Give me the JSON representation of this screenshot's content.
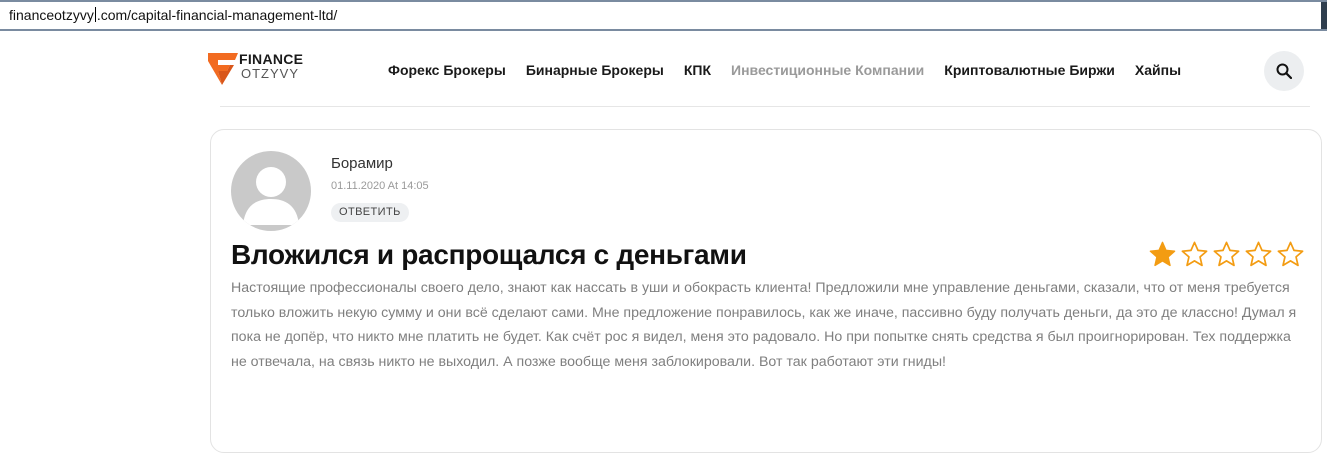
{
  "browser": {
    "url_host": "financeotzyvy",
    "url_path": ".com/capital-financial-management-ltd/"
  },
  "logo": {
    "line1": "FINANCE",
    "line2": "OTZYVY",
    "accent_color": "#f26b21"
  },
  "nav": {
    "items": [
      {
        "label": "Форекс Брокеры",
        "active": false
      },
      {
        "label": "Бинарные Брокеры",
        "active": false
      },
      {
        "label": "КПК",
        "active": false
      },
      {
        "label": "Инвестиционные Компании",
        "active": true
      },
      {
        "label": "Криптовалютные Биржи",
        "active": false
      },
      {
        "label": "Хайпы",
        "active": false
      }
    ],
    "search_icon": "search-icon"
  },
  "comment": {
    "author": "Борамир",
    "date": "01.11.2020 At 14:05",
    "reply_label": "ОТВЕТИТЬ",
    "title": "Вложился и распрощался с деньгами",
    "rating": 1,
    "rating_max": 5,
    "star_color": "#f39c12",
    "body": "Настоящие профессионалы своего дело, знают как нассать в уши и обокрасть клиента! Предложили мне управление деньгами, сказали, что от меня требуется только вложить некую сумму и они всё сделают сами. Мне предложение понравилось, как же иначе, пассивно буду получать деньги, да это де классно! Думал я пока не допёр, что никто мне платить не будет. Как счёт рос я видел, меня это радовало. Но при попытке снять средства я был проигнорирован. Тех поддержка не отвечала, на связь никто не выходил. А позже вообще меня заблокировали. Вот так работают эти гниды!"
  }
}
